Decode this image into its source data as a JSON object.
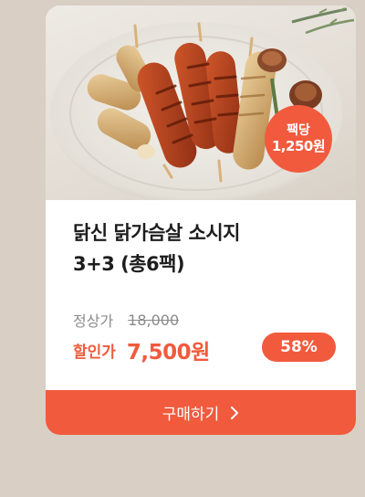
{
  "badge": {
    "line1": "팩당",
    "line2": "1,250원"
  },
  "product": {
    "title_line1": "닭신 닭가슴살 소시지",
    "title_line2": "3+3 (총6팩)"
  },
  "pricing": {
    "original_label": "정상가",
    "original_price": "18,000",
    "sale_label": "할인가",
    "sale_price": "7,500원",
    "discount": "58%"
  },
  "button": {
    "label": "구매하기",
    "icon": "chevron-right-icon"
  },
  "colors": {
    "accent": "#f15a3d",
    "background": "#d9cfc5"
  }
}
